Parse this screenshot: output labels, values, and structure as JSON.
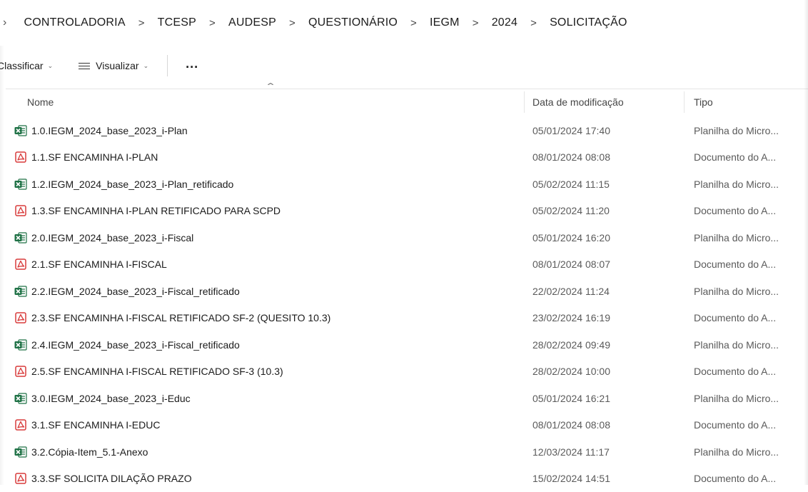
{
  "breadcrumb": {
    "lead_chevron": "›",
    "items": [
      "CONTROLADORIA",
      "TCESP",
      "AUDESP",
      "QUESTIONÁRIO",
      "IEGM",
      "2024",
      "SOLICITAÇÃO"
    ],
    "separator": ">"
  },
  "toolbar": {
    "sort_label": "Classificar",
    "view_label": "Visualizar",
    "more_label": "..."
  },
  "columns": {
    "name": "Nome",
    "date": "Data de modificação",
    "type": "Tipo"
  },
  "files": [
    {
      "icon": "excel-icon",
      "name": "1.0.IEGM_2024_base_2023_i-Plan",
      "date": "05/01/2024 17:40",
      "type": "Planilha do Micro..."
    },
    {
      "icon": "pdf-icon",
      "name": "1.1.SF ENCAMINHA I-PLAN",
      "date": "08/01/2024 08:08",
      "type": "Documento do A..."
    },
    {
      "icon": "excel-icon",
      "name": "1.2.IEGM_2024_base_2023_i-Plan_retificado",
      "date": "05/02/2024 11:15",
      "type": "Planilha do Micro..."
    },
    {
      "icon": "pdf-icon",
      "name": "1.3.SF ENCAMINHA I-PLAN RETIFICADO PARA SCPD",
      "date": "05/02/2024 11:20",
      "type": "Documento do A..."
    },
    {
      "icon": "excel-icon",
      "name": "2.0.IEGM_2024_base_2023_i-Fiscal",
      "date": "05/01/2024 16:20",
      "type": "Planilha do Micro..."
    },
    {
      "icon": "pdf-icon",
      "name": "2.1.SF ENCAMINHA I-FISCAL",
      "date": "08/01/2024 08:07",
      "type": "Documento do A..."
    },
    {
      "icon": "excel-icon",
      "name": "2.2.IEGM_2024_base_2023_i-Fiscal_retificado",
      "date": "22/02/2024 11:24",
      "type": "Planilha do Micro..."
    },
    {
      "icon": "pdf-icon",
      "name": "2.3.SF ENCAMINHA I-FISCAL RETIFICADO SF-2 (QUESITO 10.3)",
      "date": "23/02/2024 16:19",
      "type": "Documento do A..."
    },
    {
      "icon": "excel-icon",
      "name": "2.4.IEGM_2024_base_2023_i-Fiscal_retificado",
      "date": "28/02/2024 09:49",
      "type": "Planilha do Micro..."
    },
    {
      "icon": "pdf-icon",
      "name": "2.5.SF ENCAMINHA I-FISCAL RETIFICADO SF-3 (10.3)",
      "date": "28/02/2024 10:00",
      "type": "Documento do A..."
    },
    {
      "icon": "excel-icon",
      "name": "3.0.IEGM_2024_base_2023_i-Educ",
      "date": "05/01/2024 16:21",
      "type": "Planilha do Micro..."
    },
    {
      "icon": "pdf-icon",
      "name": "3.1.SF ENCAMINHA I-EDUC",
      "date": "08/01/2024 08:08",
      "type": "Documento do A..."
    },
    {
      "icon": "excel-icon",
      "name": "3.2.Cópia-Item_5.1-Anexo",
      "date": "12/03/2024 11:17",
      "type": "Planilha do Micro..."
    },
    {
      "icon": "pdf-icon",
      "name": "3.3.SF SOLICITA DILAÇÃO PRAZO",
      "date": "15/02/2024 14:51",
      "type": "Documento do A..."
    }
  ],
  "colors": {
    "excel": "#1e7145",
    "pdf": "#d83b3b",
    "header_text": "#454545",
    "secondary_text": "#5a5a5a"
  }
}
